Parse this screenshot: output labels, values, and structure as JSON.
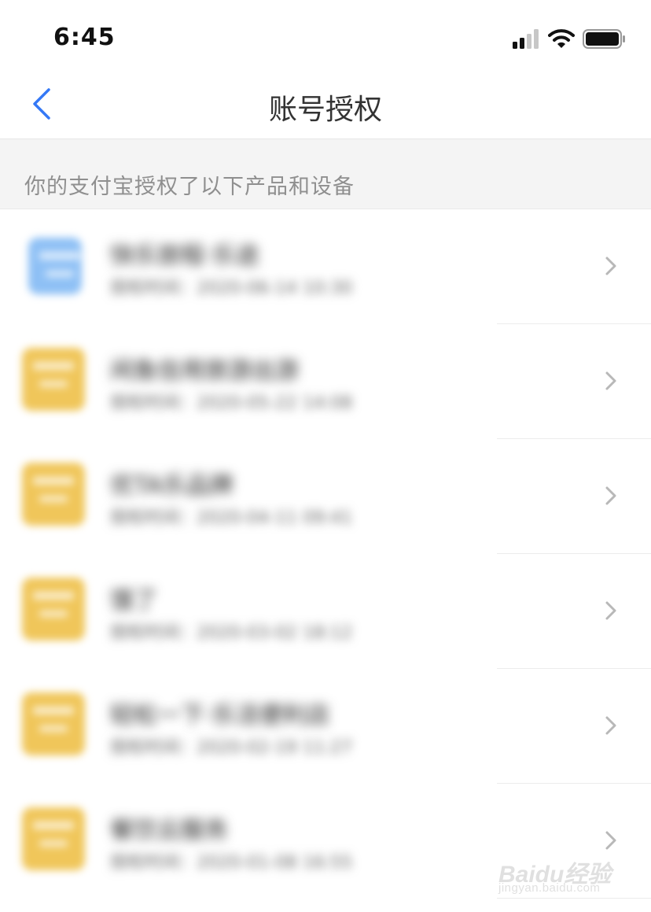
{
  "status_bar": {
    "time": "6:45"
  },
  "nav": {
    "title": "账号授权"
  },
  "section_header": "你的支付宝授权了以下产品和设备",
  "items": [
    {
      "title": "快乐旅程·乐途",
      "subtitle": "授权时间：2020-06-14 10:30",
      "icon_color": "blue"
    },
    {
      "title": "闲鱼信用旅游出游",
      "subtitle": "授权时间：2020-05-22 14:08",
      "icon_color": "yellow"
    },
    {
      "title": "优TA乐品牌",
      "subtitle": "授权时间：2020-04-11 09:41",
      "icon_color": "yellow"
    },
    {
      "title": "饿了",
      "subtitle": "授权时间：2020-03-02 18:12",
      "icon_color": "yellow"
    },
    {
      "title": "轻松一下·乐活便利店",
      "subtitle": "授权时间：2020-02-19 11:27",
      "icon_color": "yellow"
    },
    {
      "title": "餐饮云服务",
      "subtitle": "授权时间：2020-01-08 16:55",
      "icon_color": "yellow"
    }
  ],
  "watermark": {
    "logo": "Baidu经验",
    "url": "jingyan.baidu.com"
  },
  "colors": {
    "back_arrow": "#3478f6",
    "chevron": "#b8b8b8",
    "icon_blue": "#8ec0f5",
    "icon_yellow": "#f0c65a"
  }
}
